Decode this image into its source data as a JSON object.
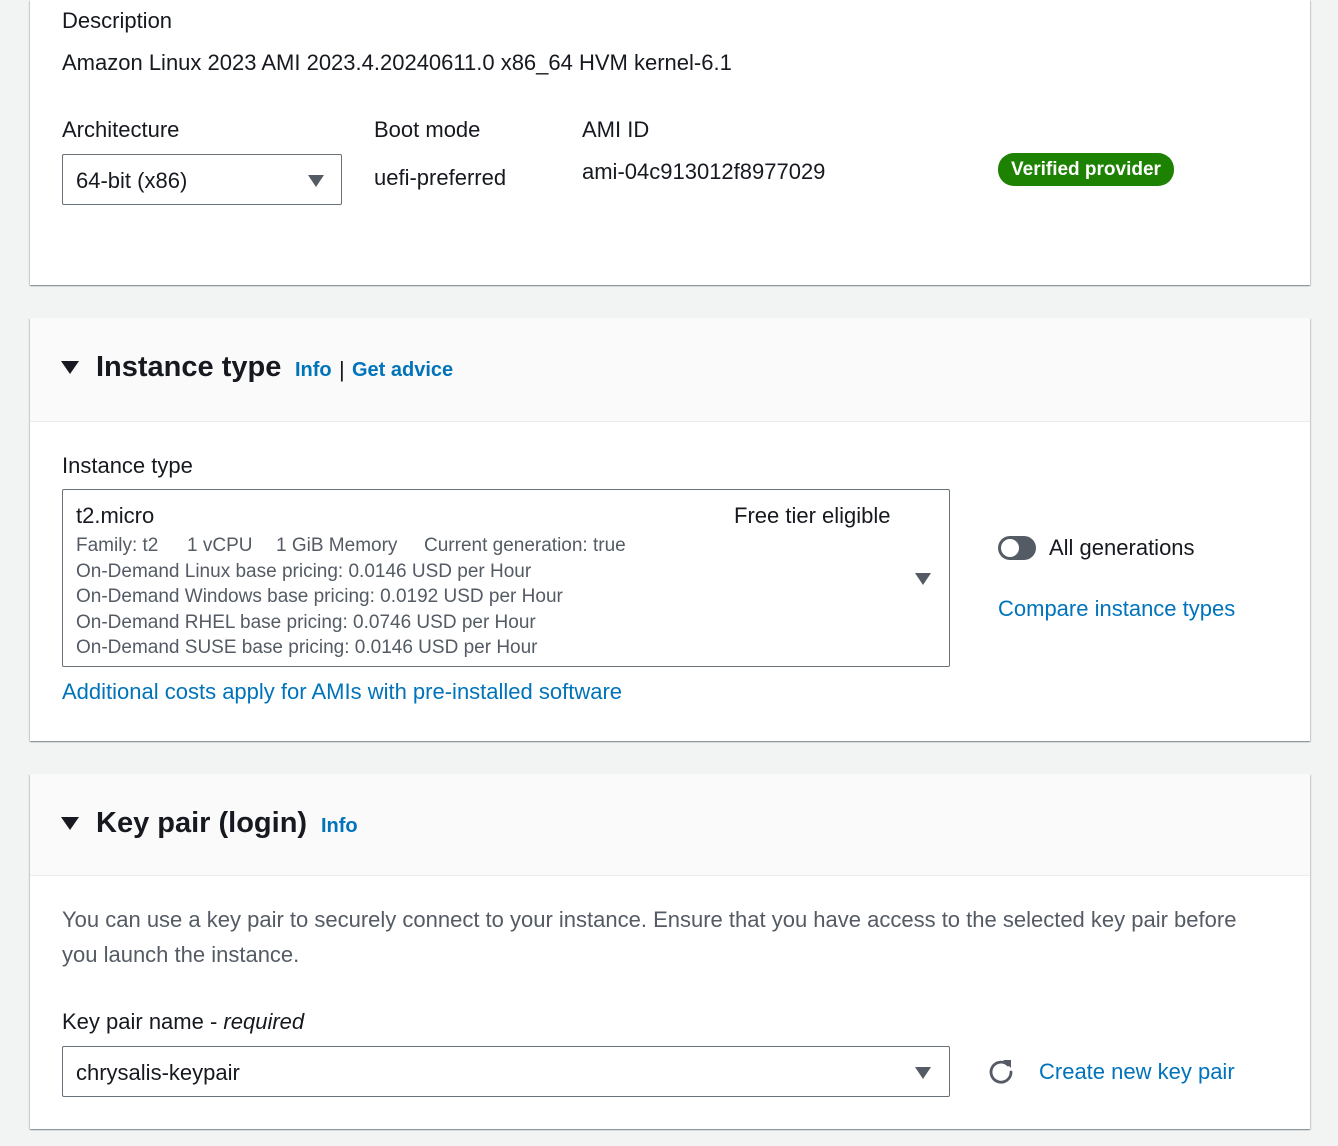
{
  "ami": {
    "description_label": "Description",
    "description_value": "Amazon Linux 2023 AMI 2023.4.20240611.0 x86_64 HVM kernel-6.1",
    "architecture_label": "Architecture",
    "architecture_value": "64-bit (x86)",
    "boot_mode_label": "Boot mode",
    "boot_mode_value": "uefi-preferred",
    "ami_id_label": "AMI ID",
    "ami_id_value": "ami-04c913012f8977029",
    "verified_badge": "Verified provider"
  },
  "instance_type": {
    "section_title": "Instance type",
    "info_link": "Info",
    "separator": "|",
    "advice_link": "Get advice",
    "field_label": "Instance type",
    "selected": {
      "name": "t2.micro",
      "free_tier": "Free tier eligible",
      "family": "Family: t2",
      "vcpu": "1 vCPU",
      "memory": "1 GiB Memory",
      "current_generation": "Current generation: true",
      "pricing": [
        "On-Demand Linux base pricing: 0.0146 USD per Hour",
        "On-Demand Windows base pricing: 0.0192 USD per Hour",
        "On-Demand RHEL base pricing: 0.0746 USD per Hour",
        "On-Demand SUSE base pricing: 0.0146 USD per Hour"
      ]
    },
    "all_generations_label": "All generations",
    "all_generations_on": false,
    "compare_link": "Compare instance types",
    "additional_costs_link": "Additional costs apply for AMIs with pre-installed software"
  },
  "key_pair": {
    "section_title": "Key pair (login)",
    "info_link": "Info",
    "description_line1": "You can use a key pair to securely connect to your instance. Ensure that you have access to the selected key pair before",
    "description_line2": "you launch the instance.",
    "field_label": "Key pair name - ",
    "field_required": "required",
    "selected_value": "chrysalis-keypair",
    "refresh_icon": "refresh-icon",
    "create_link": "Create new key pair"
  },
  "colors": {
    "link": "#0073bb",
    "badge": "#1d8102",
    "background": "#f2f3f3"
  }
}
